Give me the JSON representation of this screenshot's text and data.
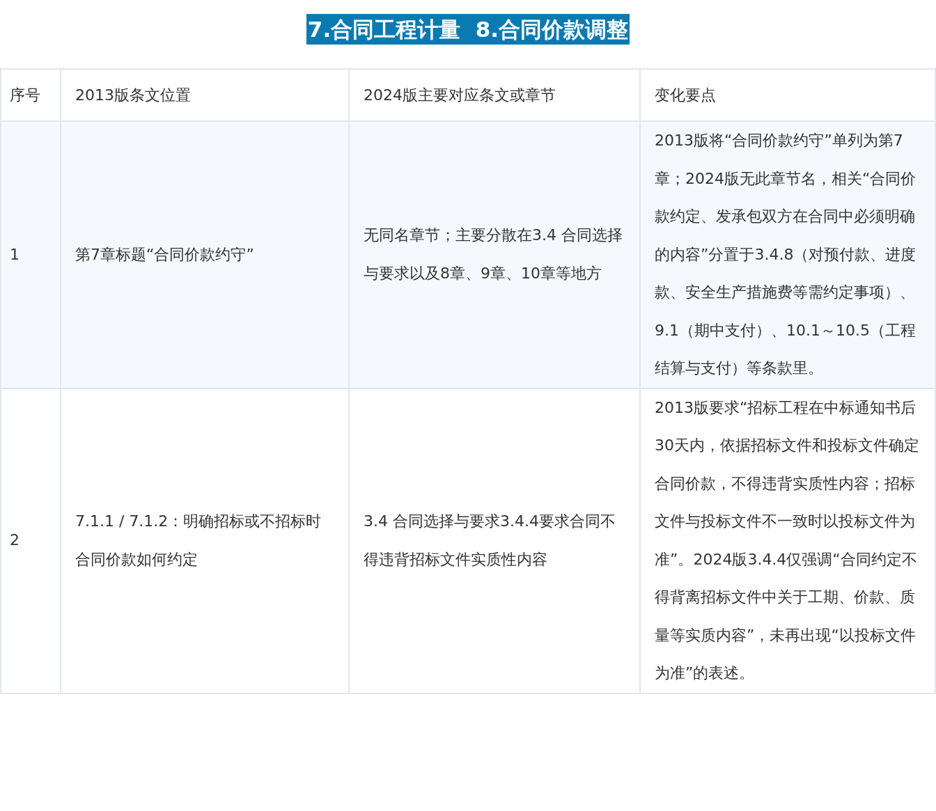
{
  "title": "7.合同工程计量  8.合同价款调整",
  "table": {
    "columns": [
      "序号",
      "2013版条文位置",
      "2024版主要对应条文或章节",
      "变化要点"
    ],
    "rows": [
      {
        "cells": [
          "1",
          "第7章标题“合同价款约守”",
          "无同名章节；主要分散在3.4 合同选择与要求以及8章、9章、10章等地方",
          "2013版将“合同价款约守”单列为第7章；2024版无此章节名，相关“合同价款约定、发承包双方在合同中必须明确的内容”分置于3.4.8（对预付款、进度款、安全生产措施费等需约定事项）、9.1（期中支付）、10.1～10.5（工程结算与支付）等条款里。"
        ]
      },
      {
        "cells": [
          "2",
          "7.1.1 / 7.1.2：明确招标或不招标时合同价款如何约定",
          "3.4 合同选择与要求3.4.4要求合同不得违背招标文件实质性内容",
          "2013版要求“招标工程在中标通知书后30天内，依据招标文件和投标文件确定合同价款，不得违背实质性内容；招标文件与投标文件不一致时以投标文件为准”。2024版3.4.4仅强调“合同约定不得背离招标文件中关于工期、价款、质量等实质内容”，未再出现“以投标文件为准”的表述。"
        ]
      }
    ]
  }
}
